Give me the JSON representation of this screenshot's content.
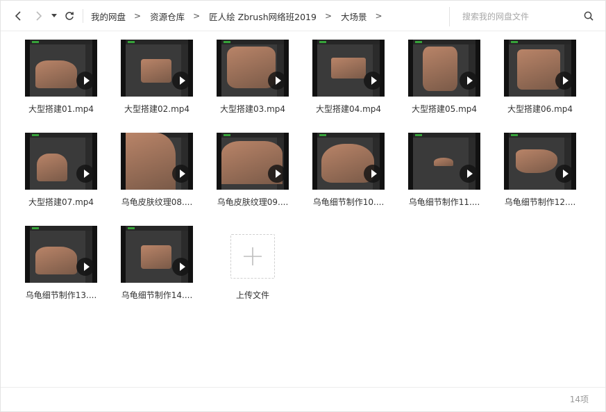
{
  "nav": {
    "back_icon": "chevron-left-icon",
    "forward_icon": "chevron-right-icon",
    "history_icon": "caret-down-icon",
    "refresh_icon": "refresh-icon"
  },
  "breadcrumb": {
    "separator": ">",
    "items": [
      "我的网盘",
      "资源仓库",
      "匠人绘 Zbrush网络班2019",
      "大场景"
    ]
  },
  "search": {
    "placeholder": "搜索我的网盘文件",
    "value": "",
    "icon": "search-icon"
  },
  "files": [
    {
      "name": "大型搭建01.mp4",
      "type": "video"
    },
    {
      "name": "大型搭建02.mp4",
      "type": "video"
    },
    {
      "name": "大型搭建03.mp4",
      "type": "video"
    },
    {
      "name": "大型搭建04.mp4",
      "type": "video"
    },
    {
      "name": "大型搭建05.mp4",
      "type": "video"
    },
    {
      "name": "大型搭建06.mp4",
      "type": "video"
    },
    {
      "name": "大型搭建07.mp4",
      "type": "video"
    },
    {
      "name": "乌龟皮肤纹理08....",
      "type": "video"
    },
    {
      "name": "乌龟皮肤纹理09....",
      "type": "video"
    },
    {
      "name": "乌龟细节制作10....",
      "type": "video"
    },
    {
      "name": "乌龟细节制作11....",
      "type": "video"
    },
    {
      "name": "乌龟细节制作12....",
      "type": "video"
    },
    {
      "name": "乌龟细节制作13....",
      "type": "video"
    },
    {
      "name": "乌龟细节制作14....",
      "type": "video"
    }
  ],
  "upload": {
    "label": "上传文件",
    "icon": "plus-icon"
  },
  "footer": {
    "count": "14项"
  },
  "colors": {
    "model_skin": "#b98468",
    "model_dark": "#7a5a48",
    "viewport": "#3a3a3a",
    "accent_green": "#37a33a"
  }
}
